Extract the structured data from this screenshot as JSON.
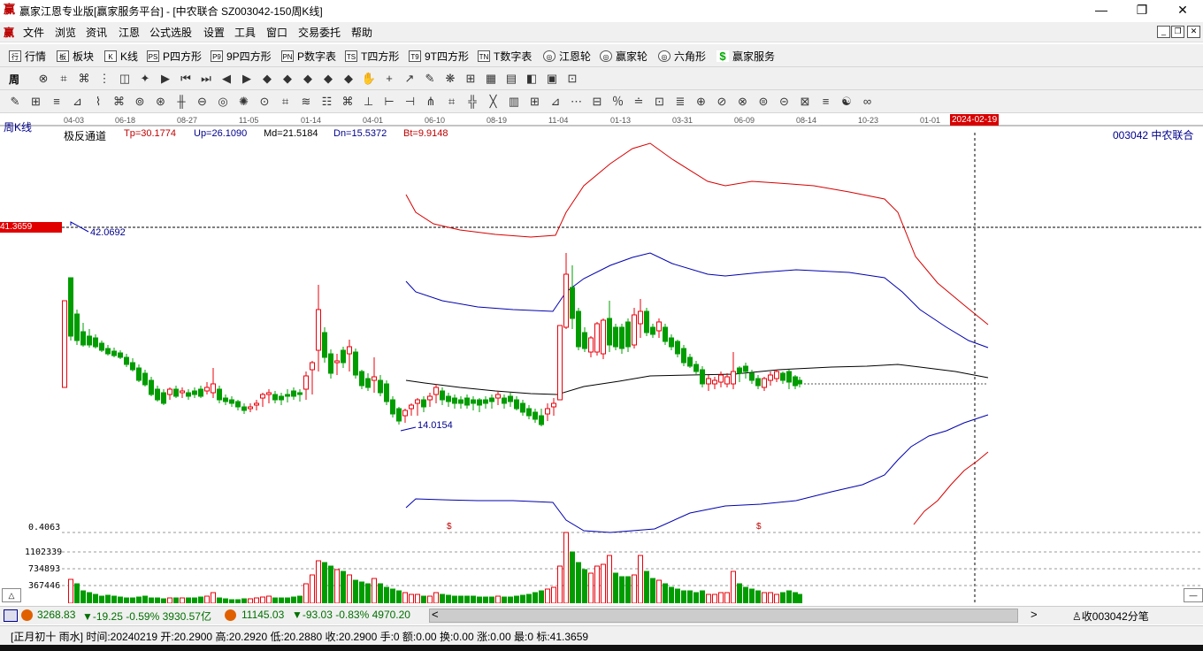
{
  "window": {
    "title": "赢家江恩专业版[赢家服务平台] - [中农联合  SZ003042-150周K线]",
    "logo": "赢",
    "controls": [
      "—",
      "❐",
      "✕"
    ]
  },
  "menu": {
    "logo": "赢",
    "items": [
      "文件",
      "浏览",
      "资讯",
      "江恩",
      "公式选股",
      "设置",
      "工具",
      "窗口",
      "交易委托",
      "帮助"
    ],
    "mdi_controls": [
      "_",
      "❐",
      "✕"
    ]
  },
  "toolbar1": {
    "items": [
      {
        "icon": "行",
        "label": "行情"
      },
      {
        "icon": "板",
        "label": "板块"
      },
      {
        "icon": "K",
        "label": "K线"
      },
      {
        "icon": "PS",
        "label": "P四方形"
      },
      {
        "icon": "P9",
        "label": "9P四方形"
      },
      {
        "icon": "PN",
        "label": "P数字表"
      },
      {
        "icon": "TS",
        "label": "T四方形"
      },
      {
        "icon": "T9",
        "label": "9T四方形"
      },
      {
        "icon": "TN",
        "label": "T数字表"
      },
      {
        "icon": "◎",
        "label": "江恩轮"
      },
      {
        "icon": "◎",
        "label": "赢家轮"
      },
      {
        "icon": "◎",
        "label": "六角形"
      },
      {
        "icon": "$",
        "label": "赢家服务"
      }
    ]
  },
  "toolbar2": {
    "period_label": "周",
    "glyphs": [
      "⊗",
      "⌗",
      "⌘",
      "⋮",
      "◫",
      "✦",
      "▶",
      "⏮",
      "⏭",
      "◀",
      "▶",
      "◆",
      "◆",
      "◆",
      "◆",
      "◆",
      "✋",
      "+",
      "↗",
      "✎",
      "❋",
      "⊞",
      "▦",
      "▤",
      "◧",
      "▣",
      "⊡"
    ]
  },
  "toolbar3": {
    "glyphs": [
      "✎",
      "⊞",
      "≡",
      "⊿",
      "⌇",
      "⌘",
      "⊚",
      "⊛",
      "╫",
      "⊖",
      "◎",
      "✺",
      "⊙",
      "⌗",
      "≋",
      "☷",
      "⌘",
      "⊥",
      "⊢",
      "⊣",
      "⋔",
      "⌗",
      "╬",
      "╳",
      "▥",
      "⊞",
      "⊿",
      "⋯",
      "⊟",
      "％",
      "≐",
      "⊡",
      "≣",
      "⊕",
      "⊘",
      "⊗",
      "⊜",
      "⊝",
      "⊠",
      "≡",
      "☯",
      "∞"
    ]
  },
  "chart": {
    "panel_label": "周K线",
    "indicator": {
      "name": "极反通道",
      "tp": "Tp=30.1774",
      "up": "Up=26.1090",
      "md": "Md=21.5184",
      "dn": "Dn=15.5372",
      "bt": "Bt=9.9148"
    },
    "stock_label": "003042  中农联合",
    "date_labels": [
      "04-03",
      "06-18",
      "08-27",
      "11-05",
      "01-14",
      "04-01",
      "06-10",
      "08-19",
      "11-04",
      "01-13",
      "03-31",
      "06-09",
      "08-14",
      "10-23",
      "01-01"
    ],
    "cursor_date": "2024-02-19",
    "price_marker": "41.3659",
    "high_label": "42.0692",
    "low_label": "14.0154",
    "volume_labels": [
      "0.4063",
      "1102339",
      "734893",
      "367446"
    ],
    "dollar_marks": [
      "$",
      "$"
    ],
    "colors": {
      "up": "#e8000b",
      "down": "#009c00",
      "red_band": "#d80000",
      "blue_band": "#0000b0",
      "mid": "#000000",
      "date_highlight": "#d80000"
    }
  },
  "bottom": {
    "sh_index": "3268.83",
    "sh_change": "▼-19.25 -0.59% 3930.57亿",
    "sz_index": "11145.03",
    "sz_change": "▼-93.03 -0.83% 4970.20",
    "scroll_left": "<",
    "scroll_right": ">",
    "search_label": "收003042分笔"
  },
  "status": {
    "text": "[正月初十 雨水] 时间:20240219 开:20.2900 高:20.2920 低:20.2880 收:20.2900 手:0 额:0.00 换:0.00 涨:0.00 最:0 标:41.3659"
  }
}
